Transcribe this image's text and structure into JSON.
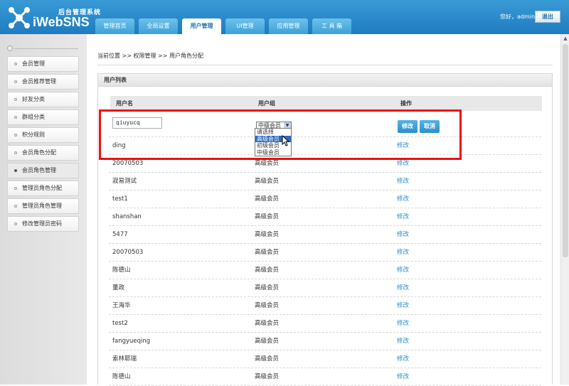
{
  "brand": {
    "subtitle": "后台管理系统",
    "name": "iWebSNS"
  },
  "nav": {
    "tabs": [
      {
        "label": "管理首页"
      },
      {
        "label": "全局设置"
      },
      {
        "label": "用户管理",
        "active": true
      },
      {
        "label": "UI管理"
      },
      {
        "label": "应用管理"
      },
      {
        "label": "工 具 箱"
      }
    ]
  },
  "user": {
    "greeting": "您好，admin",
    "logout_label": "退出"
  },
  "sidebar": {
    "items": [
      {
        "label": "会员管理"
      },
      {
        "label": "会员推荐管理"
      },
      {
        "label": "好友分类"
      },
      {
        "label": "群组分类"
      },
      {
        "label": "积分规则"
      },
      {
        "label": "会员角色分配"
      },
      {
        "label": "会员角色管理",
        "active": true
      },
      {
        "label": "管理员角色分配"
      },
      {
        "label": "管理员角色管理"
      },
      {
        "label": "修改管理员密码"
      }
    ]
  },
  "breadcrumb": "当前位置 >> 权限管理 >> 用户角色分配",
  "panel": {
    "title": "用户列表",
    "columns": {
      "name": "用户名",
      "group": "用户组",
      "action": "操作"
    }
  },
  "edit_row": {
    "name_value": "qiuyucq",
    "group_value": "中级会员",
    "save_label": "修改",
    "cancel_label": "取消",
    "options": [
      "请选择",
      "高级会员",
      "初级会员",
      "中级会员"
    ],
    "highlighted_option": "高级会员"
  },
  "rows": [
    {
      "name": "ding",
      "group": "",
      "action": "修改"
    },
    {
      "name": "20070503",
      "group": "高级会员",
      "action": "修改"
    },
    {
      "name": "寂易测试",
      "group": "高级会员",
      "action": "修改"
    },
    {
      "name": "test1",
      "group": "高级会员",
      "action": "修改"
    },
    {
      "name": "shanshan",
      "group": "高级会员",
      "action": "修改"
    },
    {
      "name": "5477",
      "group": "高级会员",
      "action": "修改"
    },
    {
      "name": "20070503",
      "group": "高级会员",
      "action": "修改"
    },
    {
      "name": "陈德山",
      "group": "高级会员",
      "action": "修改"
    },
    {
      "name": "董政",
      "group": "高级会员",
      "action": "修改"
    },
    {
      "name": "王海华",
      "group": "高级会员",
      "action": "修改"
    },
    {
      "name": "test2",
      "group": "高级会员",
      "action": "修改"
    },
    {
      "name": "fangyueqing",
      "group": "高级会员",
      "action": "修改"
    },
    {
      "name": "索林耶瑞",
      "group": "高级会员",
      "action": "修改"
    },
    {
      "name": "陈德山",
      "group": "高级会员",
      "action": "修改"
    }
  ],
  "colors": {
    "header": "#2a8bcc",
    "link": "#2a8fc8",
    "highlight": "#ee1111"
  }
}
